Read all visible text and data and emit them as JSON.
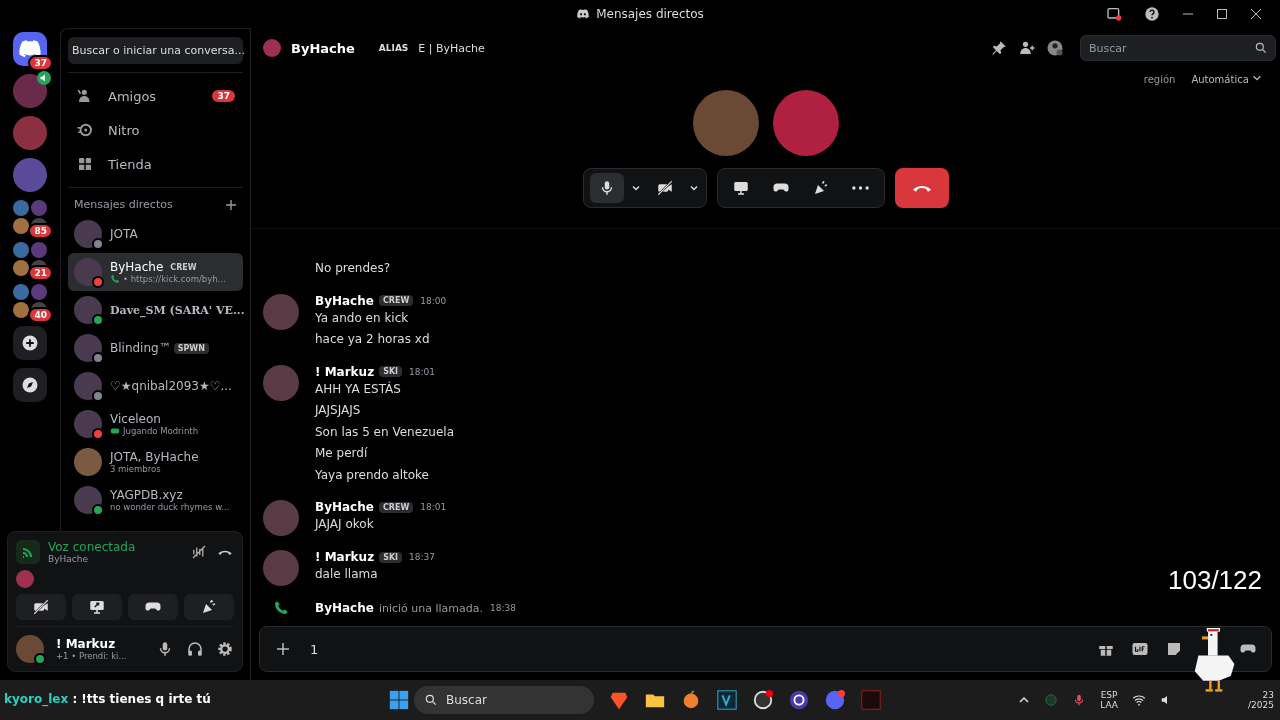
{
  "window": {
    "title": "Mensajes directos"
  },
  "servers": [
    {
      "kind": "home",
      "badge": "37",
      "selected": true
    },
    {
      "kind": "avatar",
      "color": "#6a2a4a",
      "speaking": true
    },
    {
      "kind": "avatar",
      "color": "#8a3040"
    },
    {
      "kind": "avatar",
      "color": "#5a4a9a"
    },
    {
      "kind": "folder",
      "badge": "85"
    },
    {
      "kind": "folder",
      "badge": "21"
    },
    {
      "kind": "folder",
      "badge": "40"
    },
    {
      "kind": "add"
    },
    {
      "kind": "explore"
    }
  ],
  "sidebar": {
    "search": "Buscar o iniciar una conversa...",
    "nav": [
      {
        "kind": "friends",
        "label": "Amigos",
        "badge": "37"
      },
      {
        "kind": "nitro",
        "label": "Nitro"
      },
      {
        "kind": "shop",
        "label": "Tienda"
      }
    ],
    "dm_heading": "Mensajes directos",
    "dms": [
      {
        "name": "JOTA",
        "color": "#80848e",
        "selected": false
      },
      {
        "name": "ByHache",
        "tag": "CREW",
        "subtitle": "• https://kick.com/byh...",
        "call": true,
        "color": "#f23f43",
        "selected": true
      },
      {
        "name": "Dave_SM (SARA' VE...",
        "fancy": true,
        "color": "#23a55a",
        "selected": false
      },
      {
        "name": "Blinding™",
        "tag": "SPWN",
        "color": "#80848e",
        "selected": false
      },
      {
        "name": "♡★qnibal2093★♡...",
        "color": "#80848e",
        "selected": false
      },
      {
        "name": "Viceleon",
        "subtitle": "Jugando Modrinth",
        "game": true,
        "color": "#f23f43",
        "selected": false
      },
      {
        "name": "JOTA, ByHache",
        "subtitle": "3 miembros",
        "group": true,
        "selected": false
      },
      {
        "name": "YAGPDB.xyz",
        "subtitle": "no wonder duck rhymes w...",
        "color": "#23a55a",
        "selected": false
      }
    ]
  },
  "voice": {
    "status": "Voz conectada",
    "channel": "ByHache"
  },
  "user": {
    "name": "! Markuz",
    "activity": "+1 • Prendi: ki..."
  },
  "header": {
    "name": "ByHache",
    "alias_label": "ALIAS",
    "alias": "E | ByHache",
    "search_placeholder": "Buscar",
    "region_label": "región",
    "region": "Automática"
  },
  "call": {
    "participants": [
      {
        "color": "#6b4a35"
      },
      {
        "color": "#b02040"
      }
    ],
    "mic_hover": true
  },
  "messages": [
    {
      "kind": "continuation",
      "lines": [
        "No prendes?"
      ]
    },
    {
      "kind": "message",
      "author": "ByHache",
      "tag": "CREW",
      "time": "18:00",
      "lines": [
        "Ya ando en kick",
        "hace ya 2 horas xd"
      ]
    },
    {
      "kind": "message",
      "author": "! Markuz",
      "tag": "SKI",
      "time": "18:01",
      "lines": [
        "AHH YA ESTÁS",
        "JAJSJAJS",
        "Son las 5 en Venezuela",
        "Me perdí",
        "Yaya prendo altoke"
      ]
    },
    {
      "kind": "message",
      "author": "ByHache",
      "tag": "CREW",
      "time": "18:01",
      "lines": [
        "JAJAJ okok"
      ]
    },
    {
      "kind": "message",
      "author": "! Markuz",
      "tag": "SKI",
      "time": "18:37",
      "lines": [
        "dale llama"
      ]
    },
    {
      "kind": "call",
      "author": "ByHache",
      "text": "inició una llamada.",
      "time": "18:38"
    }
  ],
  "composer": {
    "value": "1"
  },
  "taskbar": {
    "search_placeholder": "Buscar",
    "lang": "ESP",
    "layout": "LAA",
    "time": "23",
    "date": "/2025"
  },
  "overlay": {
    "counter": "103/122",
    "chat_user": "kyoro_lex",
    "chat_text": ": !tts tienes q irte tú"
  }
}
